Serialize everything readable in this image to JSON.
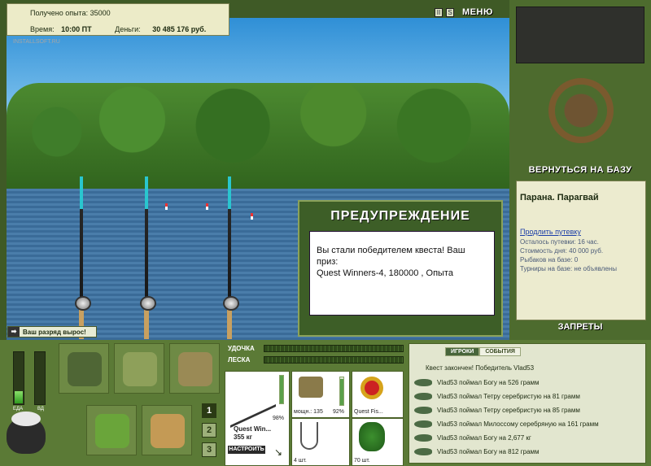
{
  "info": {
    "exp_label": "Получено опыта: 35000",
    "time_label": "Время:",
    "time_value": "10:00 ПТ",
    "money_label": "Деньги:",
    "money_value": "30 485 176 руб."
  },
  "watermark": "INSTALLSOFT.RU",
  "top_buttons": {
    "pause": "II",
    "sound": "S",
    "menu": "МЕНЮ"
  },
  "right_panel": {
    "return_label": "ВЕРНУТЬСЯ НА БАЗУ",
    "place": "Парана. Парагвай",
    "extend_link": "Продлить путевку",
    "lines": [
      "Осталось путевки: 16 час.",
      "Стоимость дня: 40 000 руб.",
      "Рыбаков на базе: 0",
      "Турниры на базе: не объявлены"
    ],
    "bans_label": "ЗАПРЕТЫ"
  },
  "dialog": {
    "title": "ПРЕДУПРЕЖДЕНИЕ",
    "line1": "Вы стали победителем квеста! Ваш приз:",
    "line2": "Quest Winners-4, 180000 , Опыта"
  },
  "banner": {
    "text": "Ваш разряд вырос!"
  },
  "meters": {
    "food_label": "ЕДА",
    "bait_label": "ВД",
    "food_level": 0.25,
    "bait_level": 0.0
  },
  "nav_buttons": [
    "1",
    "2",
    "3"
  ],
  "tackle": {
    "rod_label": "УДОЧКА",
    "line_label": "ЛЕСКА",
    "rod_name": "Quest Win...",
    "rod_weight": "355 кг",
    "rod_percent": "98%",
    "reel_caption": "мощн.: 135",
    "reel_percent": "92%",
    "line_name": "Quest Fis...",
    "hook_count": "4 шт.",
    "bait_count": "70 шт.",
    "tune_label": "НАСТРОИТЬ"
  },
  "log": {
    "tabs": [
      "ИГРОКИ",
      "СОБЫТИЯ"
    ],
    "header": "Квест закончен! Победитель Vlad53",
    "entries": [
      "Vlad53 поймал Богу на 526 грамм",
      "Vlad53 поймал Тетру серебристую на 81 грамм",
      "Vlad53 поймал Тетру серебристую на 85 грамм",
      "Vlad53 поймал Милоссому серебряную на 161 грамм",
      "Vlad53 поймал Богу на 2,677 кг",
      "Vlad53 поймал Богу на 812 грамм"
    ]
  }
}
